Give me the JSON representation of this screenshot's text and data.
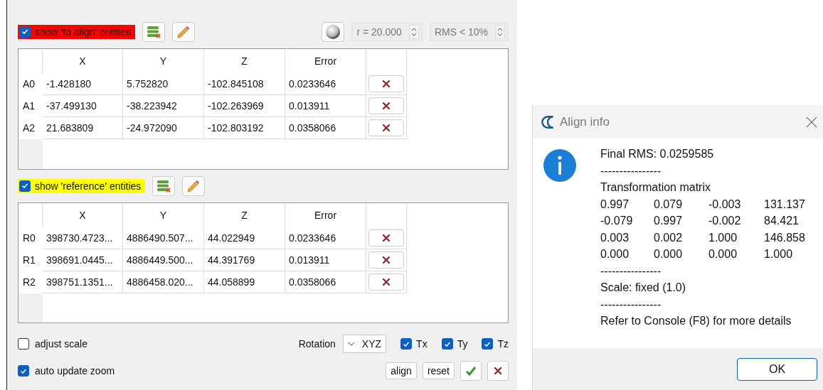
{
  "sections": [
    {
      "label": "show 'to align' entities",
      "checked": true,
      "color": "#ff0000",
      "columns": [
        "X",
        "Y",
        "Z",
        "Error"
      ],
      "rows": [
        {
          "name": "A0",
          "cells": [
            "-1.428180",
            "5.752820",
            "-102.845108",
            "0.0233646"
          ]
        },
        {
          "name": "A1",
          "cells": [
            "-37.499130",
            "-38.223942",
            "-102.263969",
            "0.013911"
          ]
        },
        {
          "name": "A2",
          "cells": [
            "21.683809",
            "-24.972090",
            "-102.803192",
            "0.0358066"
          ]
        }
      ]
    },
    {
      "label": "show 'reference' entities",
      "checked": true,
      "color": "#ffff00",
      "columns": [
        "X",
        "Y",
        "Z",
        "Error"
      ],
      "rows": [
        {
          "name": "R0",
          "cells": [
            "398730.4723...",
            "4886490.507...",
            "44.022949",
            "0.0233646"
          ]
        },
        {
          "name": "R1",
          "cells": [
            "398691.0445...",
            "4886449.500...",
            "44.391769",
            "0.013911"
          ]
        },
        {
          "name": "R2",
          "cells": [
            "398751.1351...",
            "4886458.020...",
            "44.058899",
            "0.0358066"
          ]
        }
      ]
    }
  ],
  "radius": {
    "value": "r = 20.000",
    "disabled": true
  },
  "rms": {
    "value": "RMS < 10%",
    "disabled": true
  },
  "options": [
    {
      "label": "adjust scale",
      "checked": false
    },
    {
      "label": "auto update zoom",
      "checked": true
    }
  ],
  "rotation": {
    "label": "Rotation",
    "value": "XYZ"
  },
  "translations": [
    {
      "label": "Tx",
      "checked": true
    },
    {
      "label": "Ty",
      "checked": true
    },
    {
      "label": "Tz",
      "checked": true
    }
  ],
  "buttons": [
    "align",
    "reset"
  ],
  "dialog": {
    "title": "Align info",
    "lines": [
      {
        "kind": "text",
        "text": "Final RMS: 0.0259585"
      },
      {
        "kind": "text",
        "text": "----------------"
      },
      {
        "kind": "text",
        "text": "Transformation matrix"
      },
      {
        "kind": "matrix",
        "cells": [
          "0.997",
          "0.079",
          "-0.003",
          "131.137"
        ]
      },
      {
        "kind": "matrix",
        "cells": [
          "-0.079",
          "0.997",
          "-0.002",
          "84.421"
        ]
      },
      {
        "kind": "matrix",
        "cells": [
          "0.003",
          "0.002",
          "1.000",
          "146.858"
        ]
      },
      {
        "kind": "matrix",
        "cells": [
          "0.000",
          "0.000",
          "0.000",
          "1.000"
        ]
      },
      {
        "kind": "text",
        "text": "----------------"
      },
      {
        "kind": "text",
        "text": "Scale: fixed (1.0)"
      },
      {
        "kind": "text",
        "text": "----------------"
      },
      {
        "kind": "text",
        "text": "Refer to Console (F8) for more details"
      }
    ],
    "button": "OK"
  }
}
